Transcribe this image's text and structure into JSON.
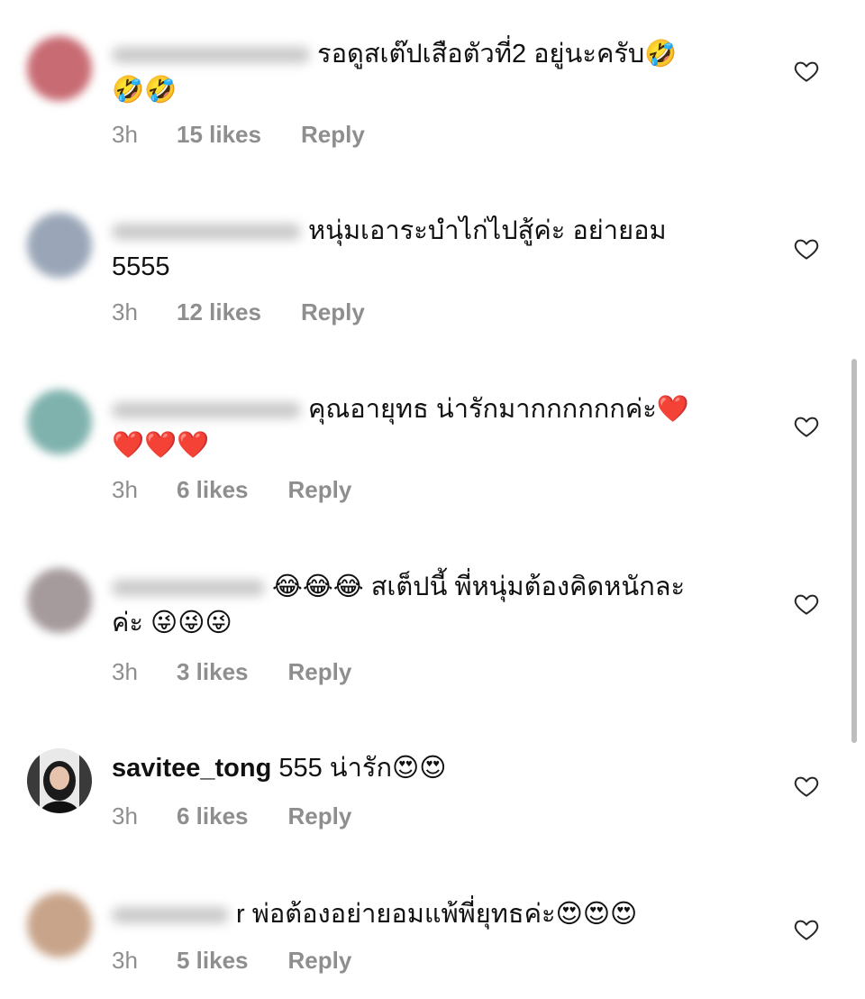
{
  "comments": [
    {
      "username": "",
      "text": "รอดูสเต๊ปเสือตัวที่2 อยู่นะครับ🤣",
      "text2": "🤣🤣",
      "time": "3h",
      "likes": "15 likes",
      "reply": "Reply",
      "avatar_color": "#c86b73"
    },
    {
      "username": "",
      "text": "หนุ่มเอาระบำไก่ไปสู้ค่ะ อย่ายอม",
      "text2": "5555",
      "time": "3h",
      "likes": "12 likes",
      "reply": "Reply",
      "avatar_color": "#9aa6b8"
    },
    {
      "username": "",
      "text": "คุณอายุทธ น่ารักมากกกกกกค่ะ❤️",
      "text2": "❤️❤️❤️",
      "time": "3h",
      "likes": "6 likes",
      "reply": "Reply",
      "avatar_color": "#7fb2ad"
    },
    {
      "username": "",
      "text": "😂😂😂 สเต็ปนี้ พี่หนุ่มต้องคิดหนักละ",
      "text2": "ค่ะ 😜😜😜",
      "time": "3h",
      "likes": "3 likes",
      "reply": "Reply",
      "avatar_color": "#a59a9c"
    },
    {
      "username": "savitee_tong",
      "text": "555 น่ารัก😍😍",
      "text2": "",
      "time": "3h",
      "likes": "6 likes",
      "reply": "Reply",
      "avatar_color": "#2a2a2a"
    },
    {
      "username": "",
      "text": "r พ่อต้องอย่ายอมแพ้พี่ยุทธค่ะ😍😍😍",
      "text2": "",
      "time": "3h",
      "likes": "5 likes",
      "reply": "Reply",
      "avatar_color": "#c8a48a"
    }
  ],
  "colors": {
    "meta": "#8e8e8e",
    "heart_outline": "#262626"
  },
  "icons": {
    "like": "heart-outline-icon"
  }
}
